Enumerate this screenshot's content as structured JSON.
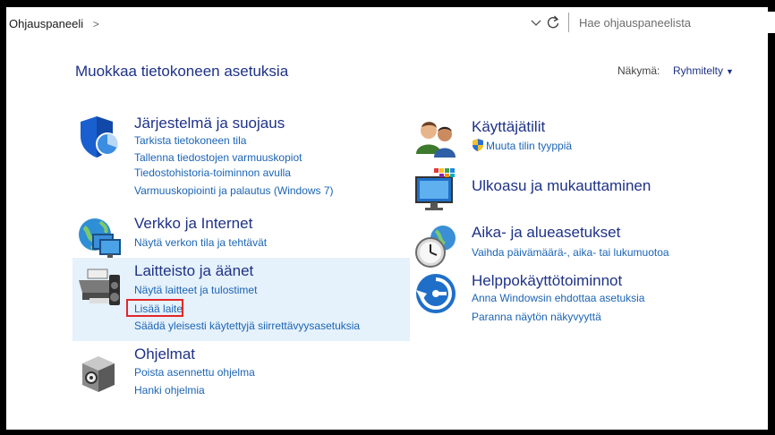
{
  "address_bar": {
    "breadcrumb": "Ohjauspaneeli",
    "breadcrumb_separator": ">",
    "search_placeholder": "Hae ohjauspaneelista"
  },
  "page": {
    "title": "Muokkaa tietokoneen asetuksia",
    "view_label": "Näkymä:",
    "view_value": "Ryhmitelty"
  },
  "categories_left": [
    {
      "title": "Järjestelmä ja suojaus",
      "icon": "shield-pie-icon",
      "links": [
        "Tarkista tietokoneen tila",
        "Tallenna tiedostojen varmuuskopiot",
        "Tiedostohistoria-toiminnon avulla",
        "Varmuuskopiointi ja palautus (Windows 7)"
      ]
    },
    {
      "title": "Verkko ja Internet",
      "icon": "globe-network-icon",
      "links": [
        "Näytä verkon tila ja tehtävät"
      ]
    },
    {
      "title": "Laitteisto ja äänet",
      "icon": "printer-speaker-icon",
      "links": [
        "Näytä laitteet ja tulostimet",
        "Lisää laite",
        "Säädä yleisesti käytettyjä siirrettävyysasetuksia"
      ]
    },
    {
      "title": "Ohjelmat",
      "icon": "programs-box-icon",
      "links": [
        "Poista asennettu ohjelma",
        "Hanki ohjelmia"
      ]
    }
  ],
  "categories_right": [
    {
      "title": "Käyttäjätilit",
      "icon": "users-icon",
      "links": [
        "Muuta tilin tyyppiä"
      ]
    },
    {
      "title": "Ulkoasu ja mukauttaminen",
      "icon": "monitor-appearance-icon",
      "links": []
    },
    {
      "title": "Aika- ja alueasetukset",
      "icon": "clock-globe-icon",
      "links": [
        "Vaihda päivämäärä-, aika- tai lukumuotoa"
      ]
    },
    {
      "title": "Helppokäyttötoiminnot",
      "icon": "ease-of-access-icon",
      "links": [
        "Anna Windowsin ehdottaa asetuksia",
        "Paranna näytön näkyvyyttä"
      ]
    }
  ],
  "colors": {
    "title": "#1e3287",
    "link": "#1b64b5",
    "highlight": "#e5f1fb",
    "annotation": "#e3262c"
  }
}
